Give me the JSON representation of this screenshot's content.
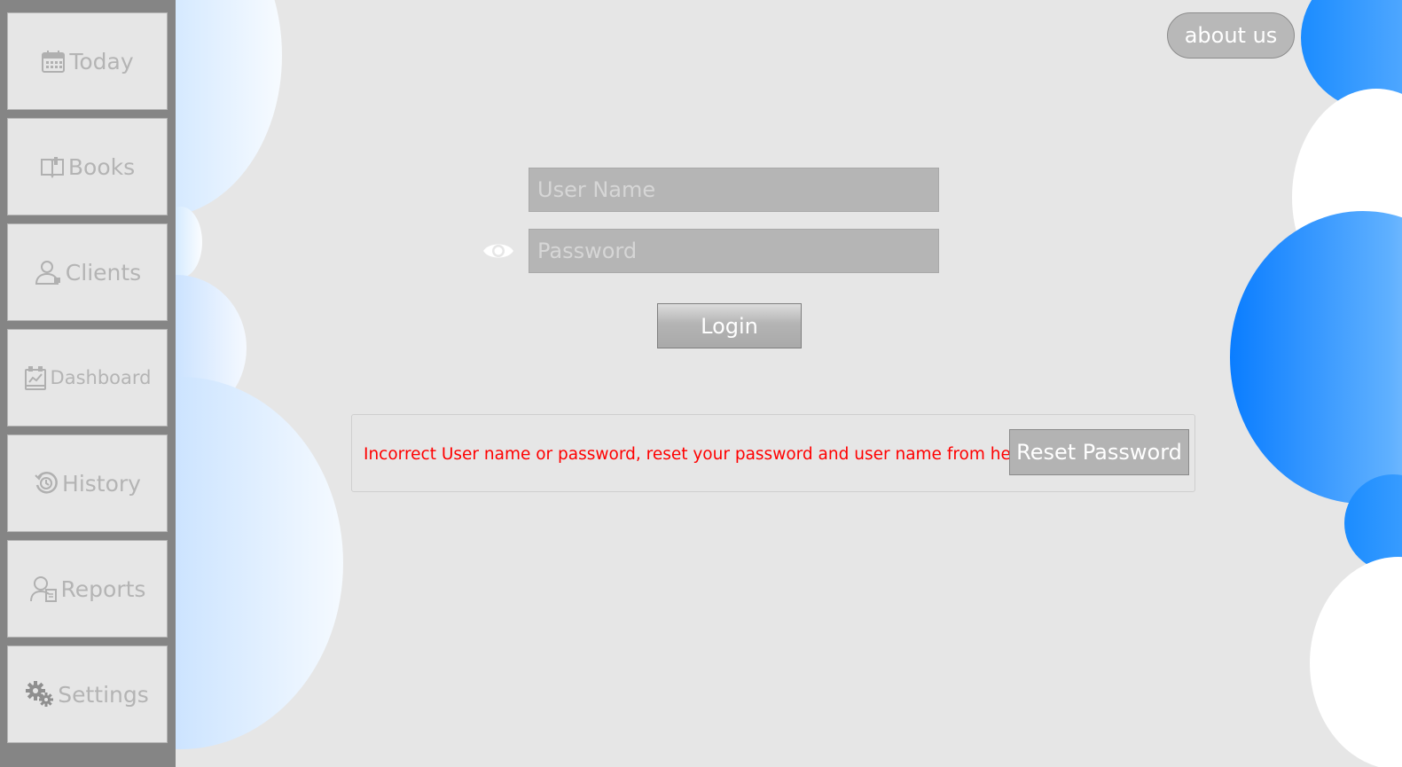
{
  "sidebar": {
    "items": [
      {
        "label": "Today",
        "icon": "calendar-icon"
      },
      {
        "label": "Books",
        "icon": "book-icon"
      },
      {
        "label": "Clients",
        "icon": "client-icon"
      },
      {
        "label": "Dashboard",
        "icon": "dashboard-icon"
      },
      {
        "label": "History",
        "icon": "history-icon"
      },
      {
        "label": "Reports",
        "icon": "report-icon"
      },
      {
        "label": "Settings",
        "icon": "gear-icon"
      }
    ]
  },
  "header": {
    "about_label": "about us"
  },
  "login": {
    "username_placeholder": "User Name",
    "password_placeholder": "Password",
    "login_label": "Login",
    "show_password_icon": "eye-icon"
  },
  "error": {
    "message": "Incorrect User name or password, reset your password and user name from here",
    "reset_label": "Reset Password",
    "color": "#ff0000"
  },
  "colors": {
    "sidebar_bg": "#858585",
    "page_bg": "#e6e6e6",
    "accent_blue": "#0a7dff"
  }
}
